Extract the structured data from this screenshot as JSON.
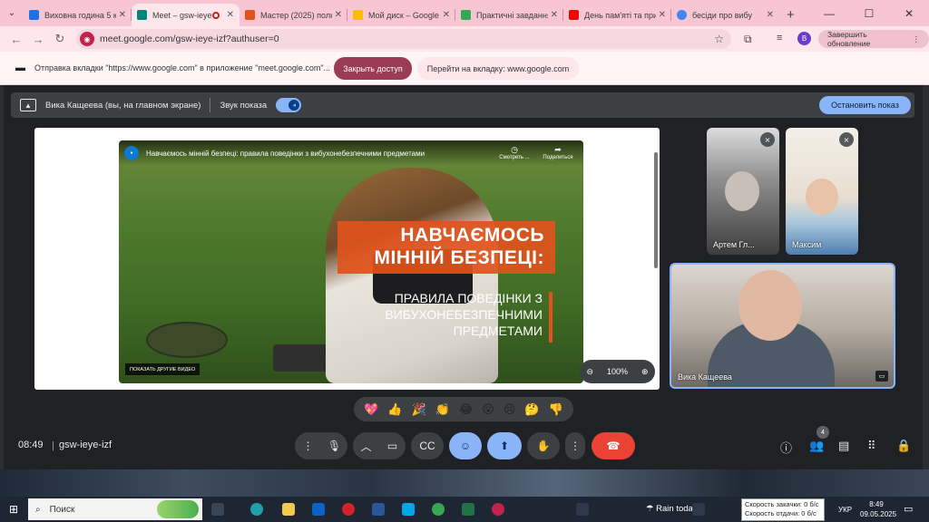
{
  "browser": {
    "tabs": [
      {
        "title": "Виховна година 5 к",
        "favicon_color": "#1a73e8",
        "active": false
      },
      {
        "title": "Meet – gsw-ieye-",
        "favicon_color": "#00897b",
        "active": true,
        "recording": true
      },
      {
        "title": "Мастер (2025) полн",
        "favicon_color": "#e0531c",
        "active": false
      },
      {
        "title": "Мой диск – Google",
        "favicon_color": "#fbbc04",
        "active": false
      },
      {
        "title": "Практичні завдання",
        "favicon_color": "#34a853",
        "active": false
      },
      {
        "title": "День пам'яті та при",
        "favicon_color": "#ff0000",
        "active": false
      },
      {
        "title": "бесіди про вибу",
        "favicon_color": "#4285f4",
        "active": false
      }
    ],
    "url": "meet.google.com/gsw-ieye-izf?authuser=0",
    "profile_initial": "B",
    "update_label": "Завершить обновление"
  },
  "notification": {
    "text": "Отправка вкладки \"https://www.google.com\" в приложение \"meet.google.com\"...",
    "stop_label": "Закрыть доступ",
    "switch_label": "Перейти на вкладку: www.google.com"
  },
  "presenting": {
    "label": "Вика Кащеева (вы, на главном экране)",
    "sound_label": "Звук показа",
    "stop_label": "Остановить показ"
  },
  "video": {
    "title": "Навчаємось мінній безпеці: правила поведінки з вибухонебезпечними предметами",
    "watch_later": "Смотреть ...",
    "share": "Поделиться",
    "headline_1": "НАВЧАЄМОСЬ",
    "headline_2": "МІННІЙ БЕЗПЕЦІ:",
    "subline_1": "ПРАВИЛА ПОВЕДІНКИ З",
    "subline_2": "ВИБУХОНЕБЕЗПЕЧНИМИ",
    "subline_3": "ПРЕДМЕТАМИ",
    "more_videos": "ПОКАЗАТЬ ДРУГИЕ ВИДЕО",
    "zoom": "100%"
  },
  "participants": [
    {
      "name": "Артем Гл...",
      "muted": true
    },
    {
      "name": "Максим",
      "muted": true
    },
    {
      "name": "Вика Кащеева",
      "muted": false
    }
  ],
  "reactions": [
    "💖",
    "👍",
    "🎉",
    "👏",
    "😂",
    "😮",
    "😢",
    "🤔",
    "👎"
  ],
  "meeting": {
    "time": "08:49",
    "code": "gsw-ieye-izf",
    "people_count": "4"
  },
  "taskbar": {
    "search_placeholder": "Поиск",
    "weather": "Rain today",
    "net_down": "Скорость закачки: 0 б/с",
    "net_up": "Скорость отдачи: 0 б/с",
    "lang": "УКР",
    "clock_time": "8:49",
    "clock_date": "09.05.2025"
  }
}
